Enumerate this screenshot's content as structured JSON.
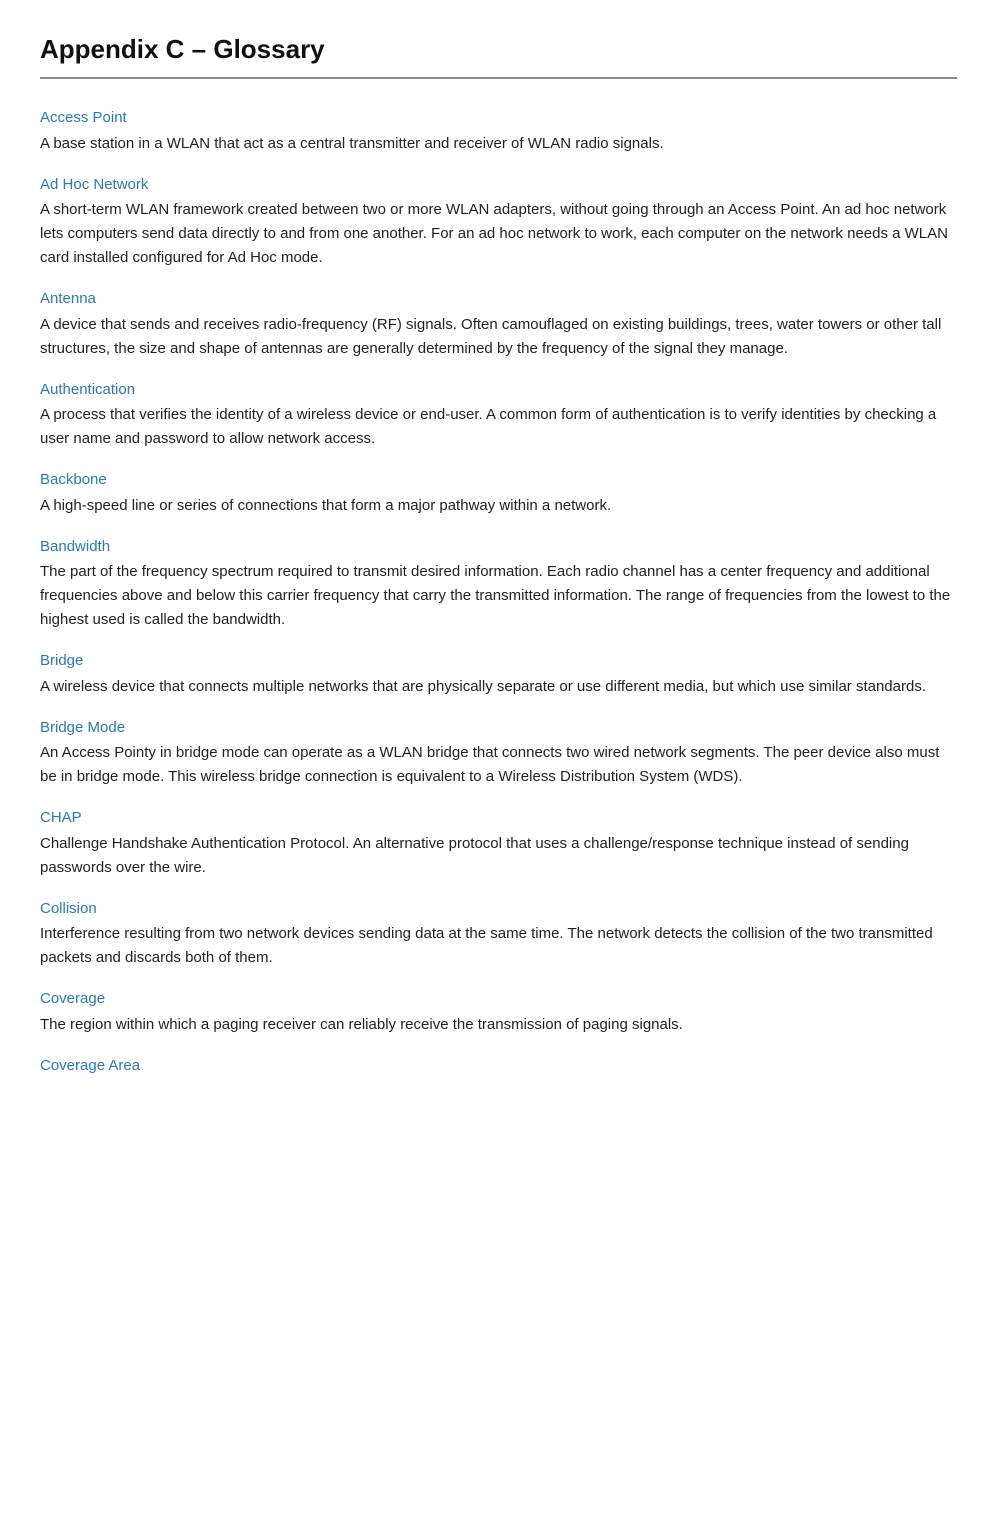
{
  "page": {
    "title": "Appendix C – Glossary"
  },
  "entries": [
    {
      "id": "access-point",
      "term": "Access Point",
      "definition": "A base station in a WLAN that act as a central transmitter and receiver of WLAN radio signals."
    },
    {
      "id": "ad-hoc-network",
      "term": "Ad Hoc Network",
      "definition": "A short-term WLAN framework created between two or more WLAN adapters, without going through an Access Point. An ad hoc network lets computers send data directly to and from one another. For an ad hoc network to work, each computer on the network needs a WLAN card installed configured for Ad Hoc mode."
    },
    {
      "id": "antenna",
      "term": "Antenna",
      "definition": "A device that sends and receives radio-frequency (RF) signals. Often camouflaged on existing buildings, trees, water towers or other tall structures, the size and shape of antennas are generally determined by the frequency of the signal they manage."
    },
    {
      "id": "authentication",
      "term": "Authentication",
      "definition": "A process that verifies the identity of a wireless device or end-user. A common form of authentication is to verify identities by checking a user name and password to allow network access."
    },
    {
      "id": "backbone",
      "term": "Backbone",
      "definition": "A high-speed line or series of connections that form a major pathway within a network."
    },
    {
      "id": "bandwidth",
      "term": "Bandwidth",
      "definition": "The part of the frequency spectrum required to transmit desired information. Each radio channel has a center frequency and additional frequencies above and below this carrier frequency that carry the transmitted information. The range of frequencies from the lowest to the highest used is called the bandwidth."
    },
    {
      "id": "bridge",
      "term": "Bridge",
      "definition": "A wireless device that connects multiple networks that are physically separate or use different media, but which use similar standards."
    },
    {
      "id": "bridge-mode",
      "term": "Bridge Mode",
      "definition": "An Access Pointy in bridge mode can operate as a WLAN bridge that connects two wired network segments. The peer device also must be in bridge mode. This wireless bridge connection is equivalent to a Wireless Distribution System (WDS)."
    },
    {
      "id": "chap",
      "term": "CHAP",
      "definition": "Challenge Handshake Authentication Protocol. An alternative protocol that uses a challenge/response technique instead of sending passwords over the wire."
    },
    {
      "id": "collision",
      "term": "Collision",
      "definition": "Interference resulting from two network devices sending data at the same time. The network detects the collision of the two transmitted packets and discards both of them."
    },
    {
      "id": "coverage",
      "term": "Coverage",
      "definition": "The region within which a paging receiver can reliably receive the transmission of paging signals."
    },
    {
      "id": "coverage-area",
      "term": "Coverage Area",
      "definition": ""
    }
  ]
}
